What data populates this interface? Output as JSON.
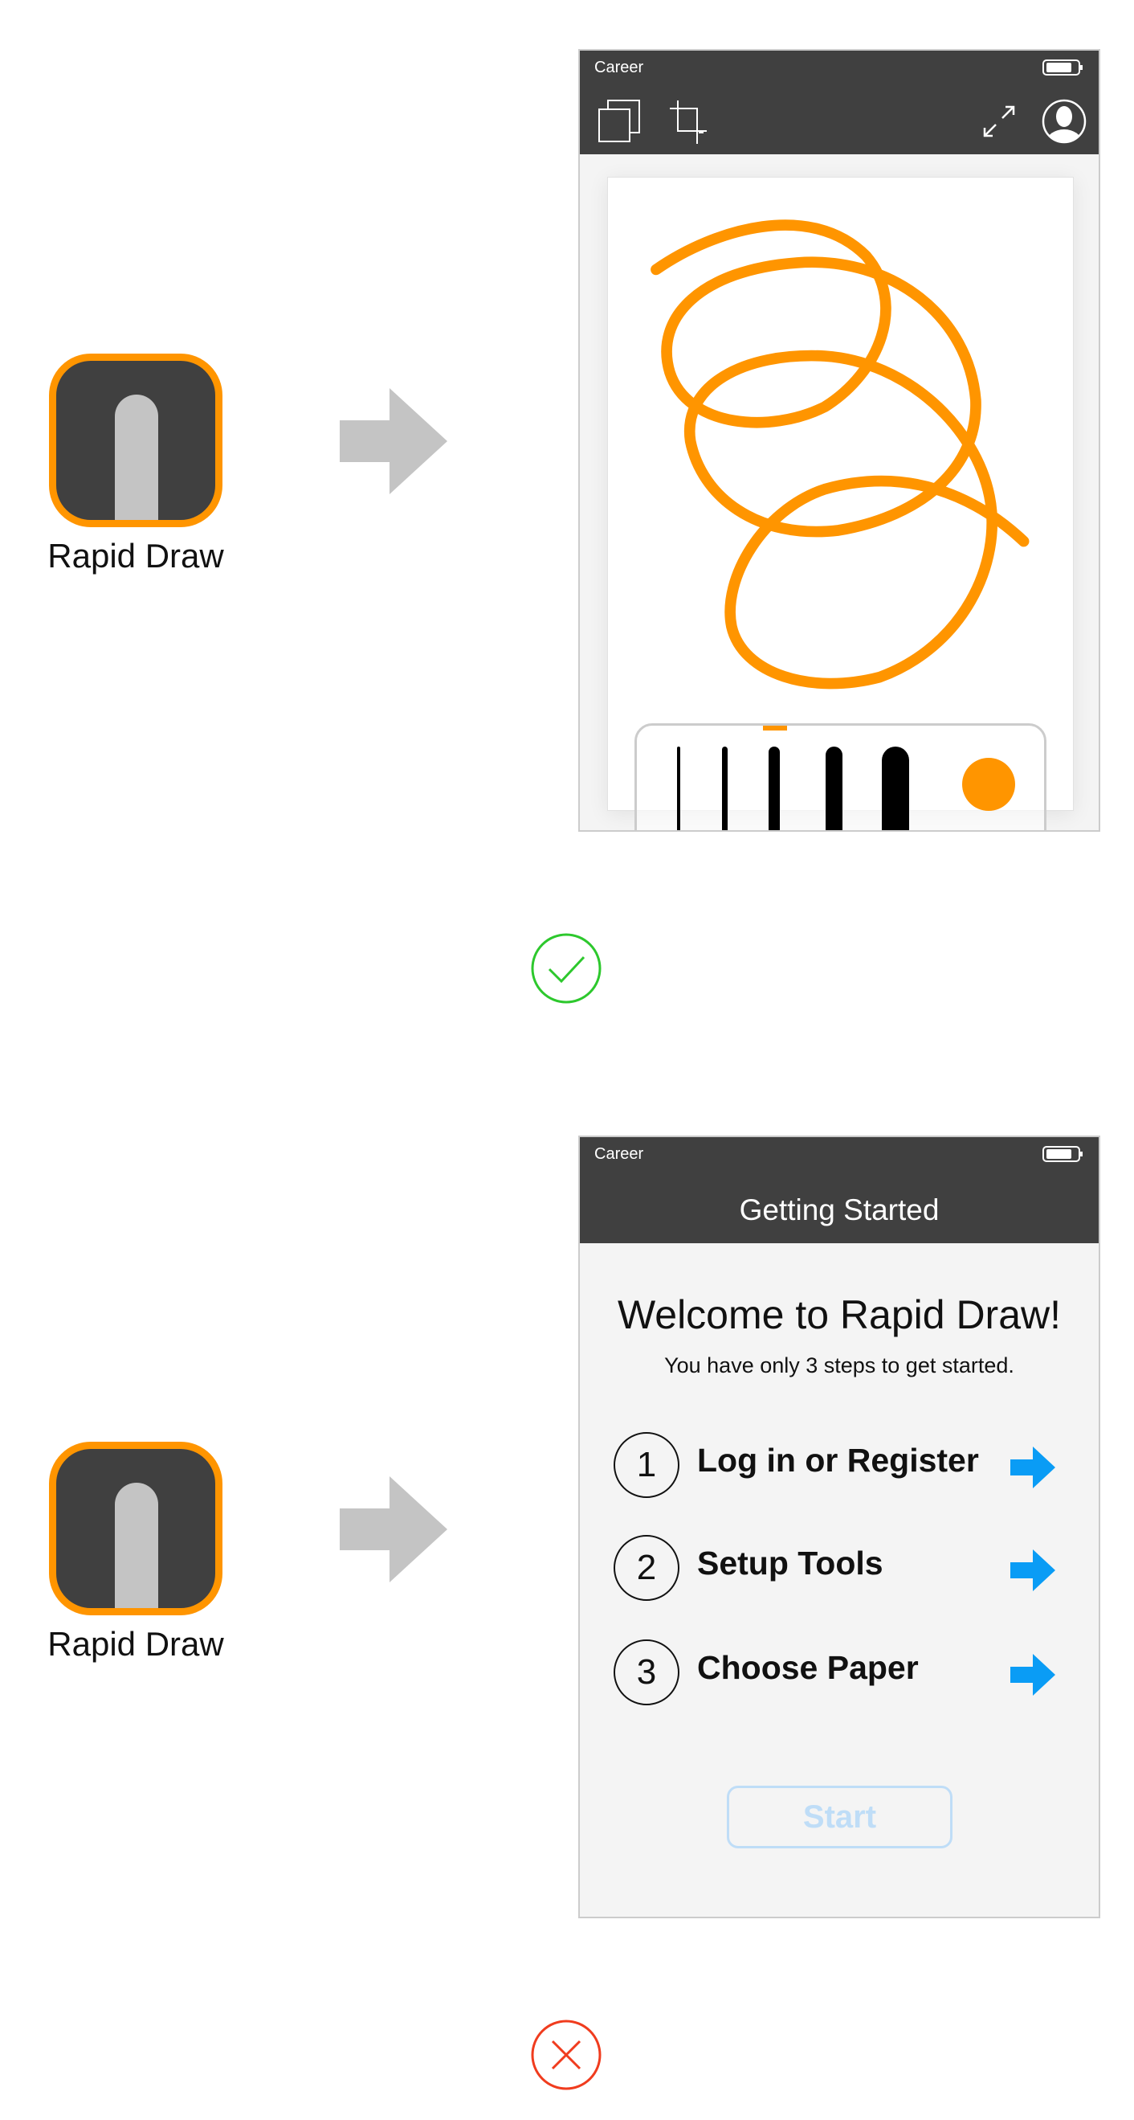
{
  "app": {
    "name": "Rapid Draw",
    "accent": "#FF9500"
  },
  "scenario_good": {
    "status": {
      "carrier": "Career"
    },
    "toolbar": {
      "icons": [
        "copy-pages-icon",
        "crop-icon",
        "expand-icon",
        "profile-icon"
      ]
    },
    "brush_tray": {
      "sizes": 5,
      "selected_index": 2,
      "color": "#FF9500"
    },
    "result_icon": "check-circle-icon",
    "result_color": "#2DC82D"
  },
  "scenario_bad": {
    "status": {
      "carrier": "Career"
    },
    "header": {
      "title": "Getting Started"
    },
    "welcome": {
      "title": "Welcome to Rapid Draw!",
      "subtitle": "You have only 3 steps to get started."
    },
    "steps": [
      {
        "number": "1",
        "label": "Log in or Register"
      },
      {
        "number": "2",
        "label": "Setup Tools"
      },
      {
        "number": "3",
        "label": "Choose Paper"
      }
    ],
    "start_label": "Start",
    "arrow_color": "#0A9CF5",
    "result_icon": "x-circle-icon",
    "result_color": "#F03C1E"
  }
}
